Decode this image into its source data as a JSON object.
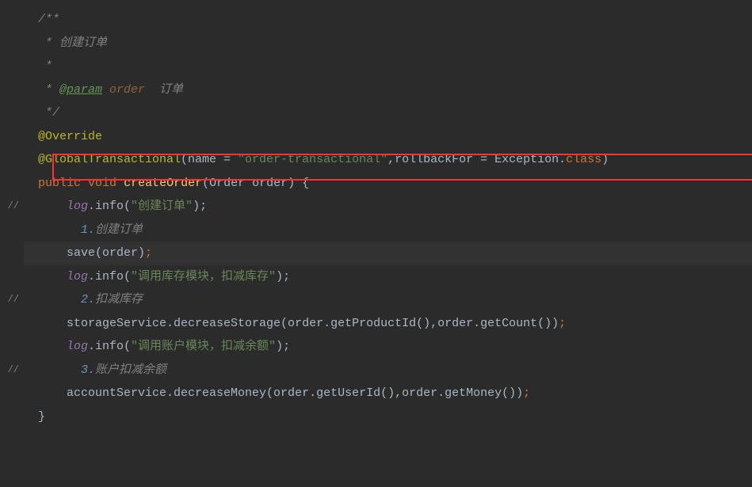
{
  "gutter": {
    "l9": "//",
    "l13": "//",
    "l16": "//"
  },
  "code": {
    "c1_open": "/**",
    "c2_star": " * ",
    "c2_text": "创建订单",
    "c3_star": " *",
    "c4_star": " * ",
    "c4_tag": "@param",
    "c4_param": " order  ",
    "c4_desc": "订单",
    "c5_close": " */",
    "l6_ann": "@Override",
    "l7_ann": "@GlobalTransactional",
    "l7_p1": "(name = ",
    "l7_s1": "\"order-transactional\"",
    "l7_p2": ",rollbackFor = Exception.",
    "l7_kw": "class",
    "l7_p3": ")",
    "l8_kw1": "public",
    "l8_kw2": "void",
    "l8_method": "createOrder",
    "l8_sig": "(Order order) {",
    "l9_field": "log",
    "l9_p1": ".info(",
    "l9_str": "\"创建订单\"",
    "l9_p2": ");",
    "l10_num": "1.",
    "l10_text": "创建订单",
    "l11_call": "save(order)",
    "l11_semi": ";",
    "l12_field": "log",
    "l12_p1": ".info(",
    "l12_str": "\"调用库存模块，扣减库存\"",
    "l12_p2": ");",
    "l13_num": "2.",
    "l13_text": "扣减库存",
    "l14_call": "storageService.decreaseStorage(order.getProductId(),order.getCount())",
    "l14_semi": ";",
    "l15_field": "log",
    "l15_p1": ".info(",
    "l15_str": "\"调用账户模块，扣减余额\"",
    "l15_p2": ");",
    "l16_num": "3.",
    "l16_text": "账户扣减余额",
    "l17_call": "accountService.decreaseMoney(order.getUserId(),order.getMoney())",
    "l17_semi": ";",
    "l18_brace": "}"
  }
}
